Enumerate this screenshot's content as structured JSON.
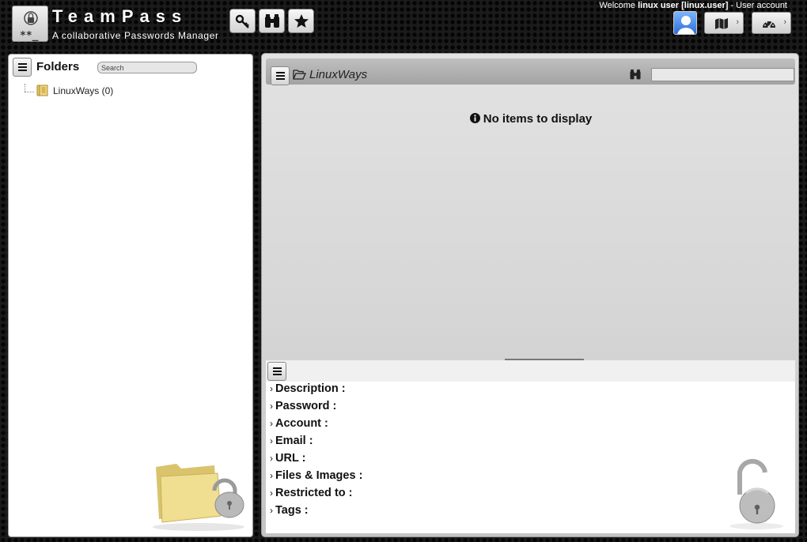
{
  "header": {
    "title": "TeamPass",
    "subtitle": "A collaborative Passwords Manager",
    "logo_text": "**_",
    "tools": [
      {
        "name": "keys-icon"
      },
      {
        "name": "binoculars-icon"
      },
      {
        "name": "star-icon"
      }
    ],
    "welcome_prefix": "Welcome ",
    "user_name": "linux user [linux.user]",
    "welcome_suffix": " - User account",
    "menu_buttons": [
      {
        "icon": "map-icon",
        "chevron": "›"
      },
      {
        "icon": "dashboard-icon",
        "chevron": "›"
      }
    ]
  },
  "folders": {
    "title": "Folders",
    "search_placeholder": "Search",
    "items": [
      {
        "label": "LinuxWays (0)"
      }
    ]
  },
  "items_panel": {
    "folder_name": "LinuxWays",
    "empty_message": "No items to display"
  },
  "details": {
    "rows": [
      {
        "label": "Description :"
      },
      {
        "label": "Password :"
      },
      {
        "label": "Account :"
      },
      {
        "label": "Email :"
      },
      {
        "label": "URL :"
      },
      {
        "label": "Files & Images :"
      },
      {
        "label": "Restricted to :"
      },
      {
        "label": "Tags :"
      }
    ],
    "chevron": "›"
  },
  "colors": {
    "background": "#1b1b1b",
    "panel": "#ffffff",
    "header_bar": "#a8a8a8",
    "avatar_blue": "#3c7be0"
  }
}
